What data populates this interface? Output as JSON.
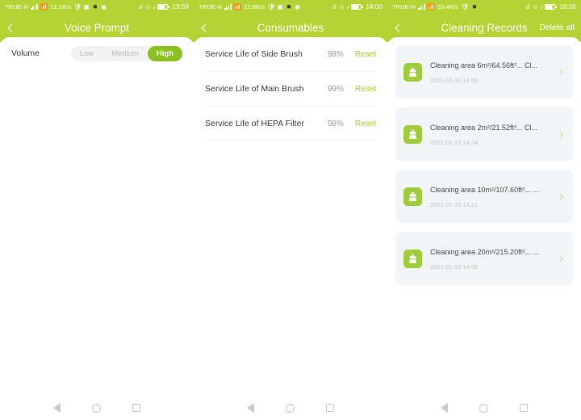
{
  "panels": [
    {
      "status": {
        "carrier": "TRUE-H",
        "speed": "12.1K/s",
        "time": "13:59",
        "icons": [
          "signal-icon",
          "wifi-icon",
          "shield-icon",
          "camera-icon",
          "dnd-icon",
          "circle-icon",
          "key-icon",
          "bluetooth-icon",
          "vibrate-icon",
          "battery-icon"
        ]
      },
      "header": {
        "title": "Voice Prompt",
        "back": "back-chevron-icon",
        "action": ""
      },
      "volume": {
        "label": "Volume",
        "options": [
          {
            "label": "Low",
            "selected": false
          },
          {
            "label": "Medium",
            "selected": false
          },
          {
            "label": "High",
            "selected": true
          }
        ]
      }
    },
    {
      "status": {
        "carrier": "TRUE-H",
        "speed": "12.8K/s",
        "time": "14:00",
        "icons": [
          "signal-icon",
          "wifi-icon",
          "shield-icon",
          "camera-icon",
          "dnd-icon",
          "circle-icon",
          "key-icon",
          "bluetooth-icon",
          "vibrate-icon",
          "battery-icon"
        ]
      },
      "header": {
        "title": "Consumables",
        "back": "back-chevron-icon",
        "action": ""
      },
      "consumables": {
        "reset_label": "Reset",
        "rows": [
          {
            "name": "Service Life of Side Brush",
            "percent": "98%"
          },
          {
            "name": "Service Life of Main Brush",
            "percent": "99%"
          },
          {
            "name": "Service Life of HEPA Filter",
            "percent": "98%"
          }
        ]
      }
    },
    {
      "status": {
        "carrier": "TRUE-H",
        "speed": "53.4K/s",
        "time": "16:50",
        "icons": [
          "signal-icon",
          "wifi-icon",
          "shield-icon",
          "dnd-icon",
          "key-icon",
          "bluetooth-icon",
          "vibrate-icon",
          "battery-icon"
        ]
      },
      "header": {
        "title": "Cleaning Records",
        "back": "back-chevron-icon",
        "action": "Delete all"
      },
      "records": [
        {
          "title": "Cleaning area 6m²/64.56ft²... Cl...",
          "date": "2021-01-16 14:59"
        },
        {
          "title": "Cleaning area 2m²/21.52ft²... Cl...",
          "date": "2021-01-16 14:24"
        },
        {
          "title": "Cleaning area 10m²/107.60ft²... ...",
          "date": "2021-01-16 14:21"
        },
        {
          "title": "Cleaning area 20m²/215.20ft²... ...",
          "date": "2021-01-16 14:06"
        }
      ]
    }
  ],
  "navbar": {
    "back": "nav-back-icon",
    "home": "nav-home-icon",
    "recents": "nav-recents-icon"
  },
  "colors": {
    "header_green": "#b5d334",
    "accent_green": "#8bc220",
    "reset_green": "#a8ca3a",
    "card_bg": "#f2f5f7"
  }
}
